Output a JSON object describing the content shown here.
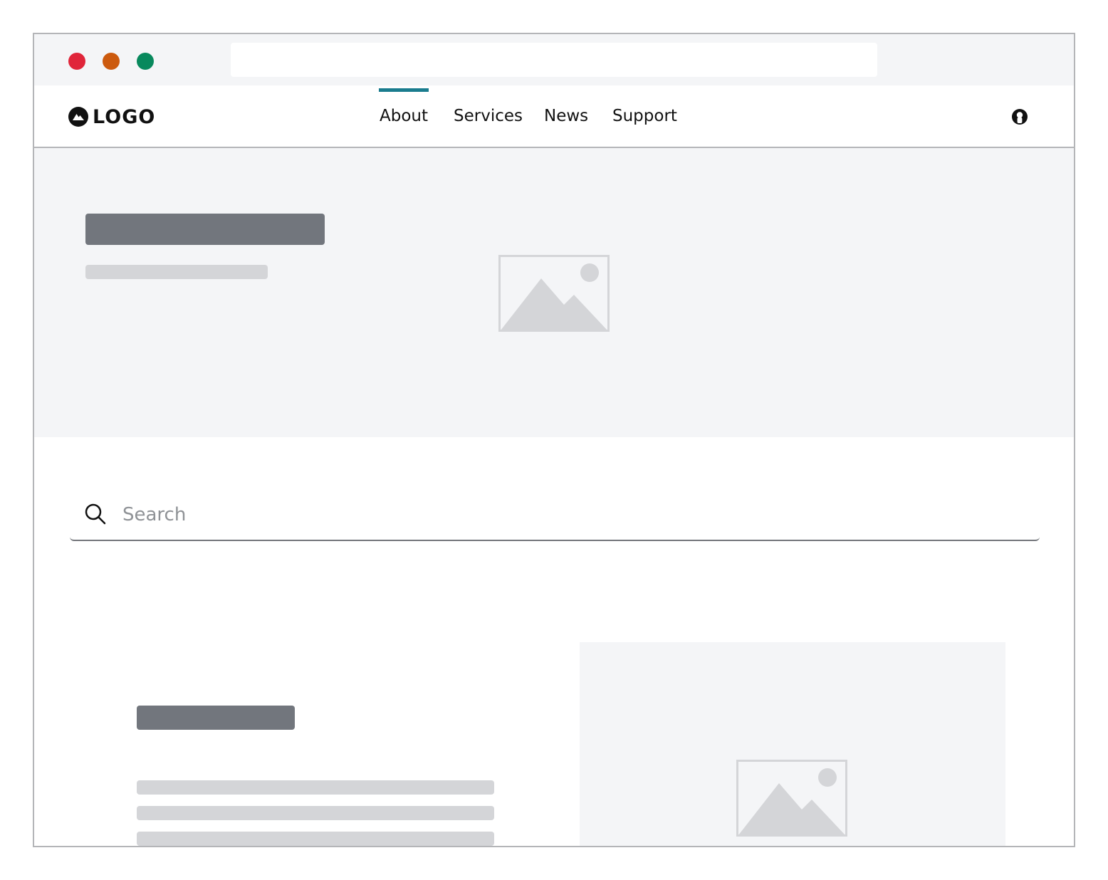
{
  "window": {
    "traffic_lights": {
      "close_color": "#e0253a",
      "minimize_color": "#cc5a0e",
      "maximize_color": "#08895d"
    },
    "address_bar_value": ""
  },
  "header": {
    "logo_text": "LOGO",
    "nav": [
      {
        "label": "About",
        "active": true
      },
      {
        "label": "Services",
        "active": false
      },
      {
        "label": "News",
        "active": false
      },
      {
        "label": "Support",
        "active": false
      }
    ],
    "accent_color": "#1a7c8e",
    "user_icon": "user-avatar-icon"
  },
  "hero": {
    "image_icon": "image-placeholder-icon"
  },
  "search": {
    "placeholder": "Search",
    "value": "",
    "icon": "search-icon"
  },
  "feature": {
    "image_icon": "image-placeholder-icon"
  },
  "colors": {
    "background_panel": "#f4f5f7",
    "placeholder_dark": "#72767d",
    "placeholder_light": "#d4d5d8",
    "border": "#b4b5b8"
  }
}
